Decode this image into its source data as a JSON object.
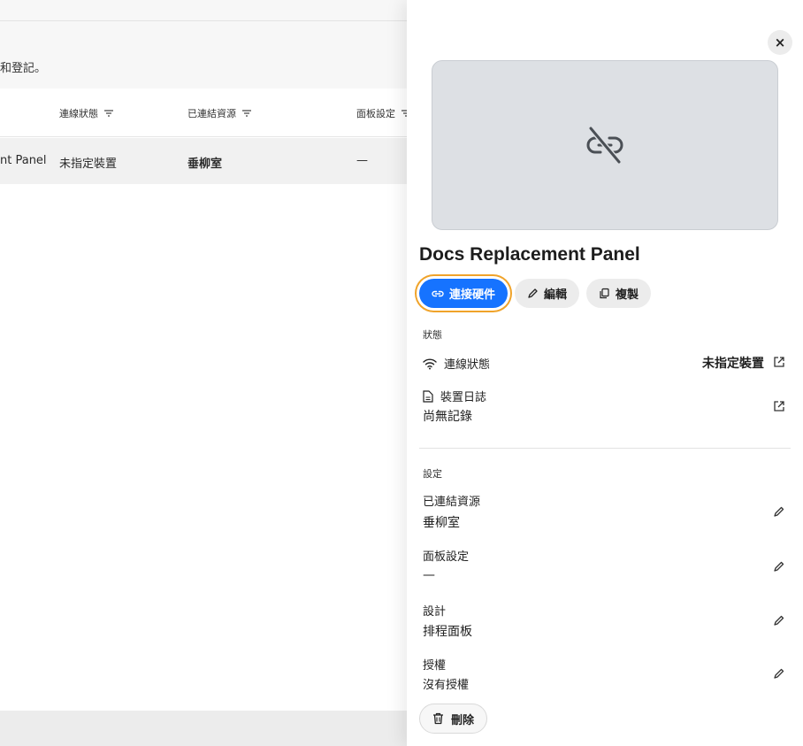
{
  "background": {
    "description": "和登記。",
    "table": {
      "columns": [
        "連線狀態",
        "已連結資源",
        "面板設定"
      ],
      "row": {
        "name": "nt Panel",
        "status": "未指定裝置",
        "resource": "垂柳室",
        "panel_setting": "—"
      }
    }
  },
  "panel": {
    "close_label": "×",
    "title": "Docs Replacement Panel",
    "actions": {
      "connect": "連接硬件",
      "edit": "編輯",
      "duplicate": "複製"
    },
    "status_section": {
      "label": "狀態",
      "connection_label": "連線狀態",
      "connection_value": "未指定裝置",
      "log_label": "裝置日誌",
      "log_value": "尚無記錄"
    },
    "settings_section": {
      "label": "設定",
      "items": [
        {
          "label": "已連結資源",
          "value": "垂柳室"
        },
        {
          "label": "面板設定",
          "value": "—"
        },
        {
          "label": "設計",
          "value": "排程面板"
        },
        {
          "label": "授權",
          "value": "沒有授權"
        }
      ]
    },
    "delete_label": "刪除"
  },
  "colors": {
    "accent": "#1673ff",
    "focus_ring": "#f0a32a"
  }
}
